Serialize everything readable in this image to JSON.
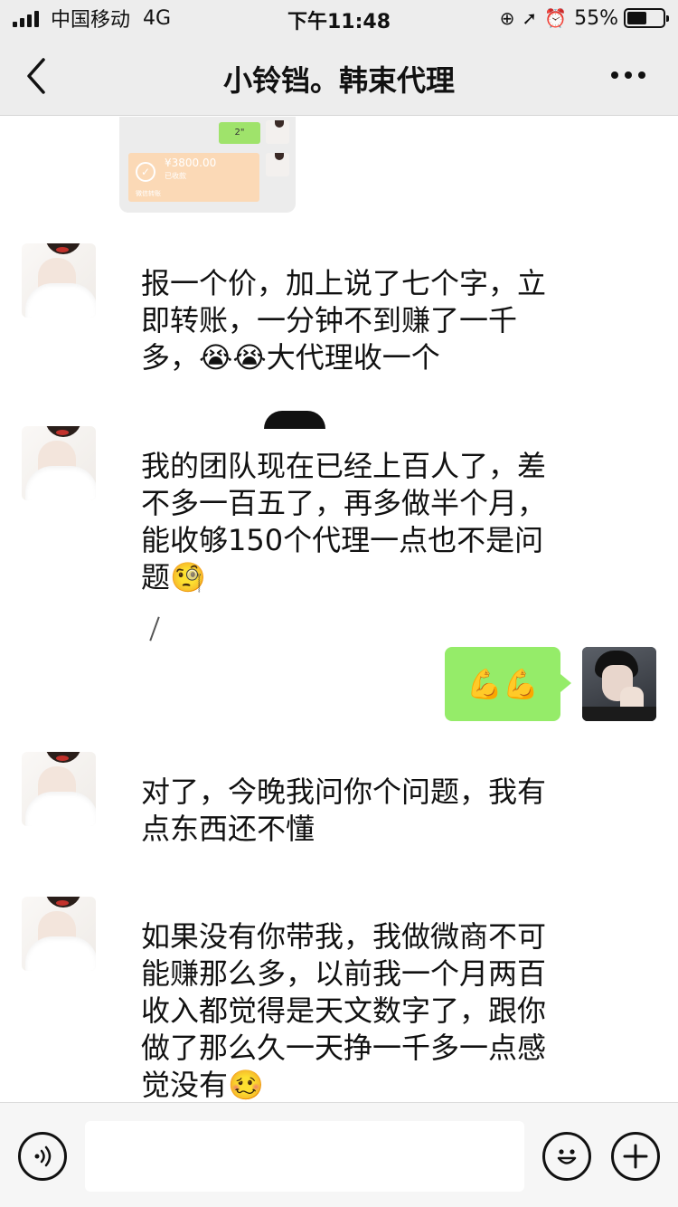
{
  "status_bar": {
    "carrier": "中国移动",
    "network": "4G",
    "time": "下午11:48",
    "battery": "55%",
    "battery_level": 0.55
  },
  "nav": {
    "back_icon": "chevron-left-icon",
    "title": "小铃铛。韩束代理",
    "more_icon": "more-dots-icon"
  },
  "screenshot_preview": {
    "voice_label": "2\"",
    "transfer_amount": "¥3800.00",
    "transfer_sub": "已收款",
    "transfer_foot": "微信转账"
  },
  "messages": [
    {
      "side": "left",
      "text": "报一个价，加上说了七个字，立即转账，一分钟不到赚了一千多，😭😭大代理收一个"
    },
    {
      "side": "left",
      "text": "我的团队现在已经上百人了，差不多一百五了，再多做半个月，能收够150个代理一点也不是问题🧐"
    },
    {
      "side": "right",
      "text": "💪💪"
    },
    {
      "side": "left",
      "text": "对了，今晚我问你个问题，我有点东西还不懂"
    },
    {
      "side": "left",
      "text": "如果没有你带我，我做微商不可能赚那么多，以前我一个月两百收入都觉得是天文数字了，跟你做了那么久一天挣一千多一点感觉没有🥴"
    }
  ],
  "input_bar": {
    "voice_icon": "voice-icon",
    "text_value": "",
    "emoji_icon": "emoji-icon",
    "plus_icon": "plus-icon"
  },
  "colors": {
    "header_bg": "#ededed",
    "bubble_right": "#95ec69",
    "chat_bg": "#ffffff",
    "input_bar_bg": "#f6f6f6"
  }
}
